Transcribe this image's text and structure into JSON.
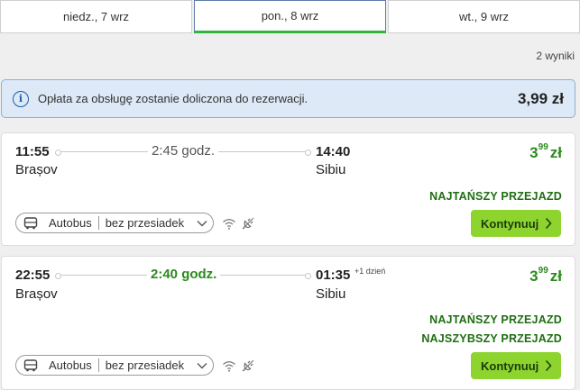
{
  "tabs": [
    {
      "label": "niedz., 7 wrz"
    },
    {
      "label": "pon., 8 wrz"
    },
    {
      "label": "wt., 9 wrz"
    }
  ],
  "results_count": "2 wyniki",
  "info": {
    "icon": "info-icon",
    "text": "Opłata za obsługę zostanie doliczona do rezerwacji.",
    "price": "3,99 zł"
  },
  "trips": [
    {
      "departure_time": "11:55",
      "departure_city": "Brașov",
      "duration": "2:45 godz.",
      "arrival_time": "14:40",
      "arrival_city": "Sibiu",
      "next_day": "",
      "price_main": "3",
      "price_cents": "99",
      "price_currency": "zł",
      "badges": [
        "NAJTAŃSZY PRZEJAZD"
      ],
      "transport": "Autobus",
      "transfers": "bez przesiadek",
      "button": "Kontynuuj"
    },
    {
      "departure_time": "22:55",
      "departure_city": "Brașov",
      "duration": "2:40 godz.",
      "arrival_time": "01:35",
      "arrival_city": "Sibiu",
      "next_day": "+1 dzień",
      "price_main": "3",
      "price_cents": "99",
      "price_currency": "zł",
      "badges": [
        "NAJTAŃSZY PRZEJAZD",
        "NAJSZYBSZY PRZEJAZD"
      ],
      "transport": "Autobus",
      "transfers": "bez przesiadek",
      "button": "Kontynuuj"
    }
  ],
  "colors": {
    "accent_green": "#8ed42f",
    "badge_green": "#1f6e12",
    "price_green": "#2a8a1c",
    "info_bg": "#dde9f6"
  }
}
